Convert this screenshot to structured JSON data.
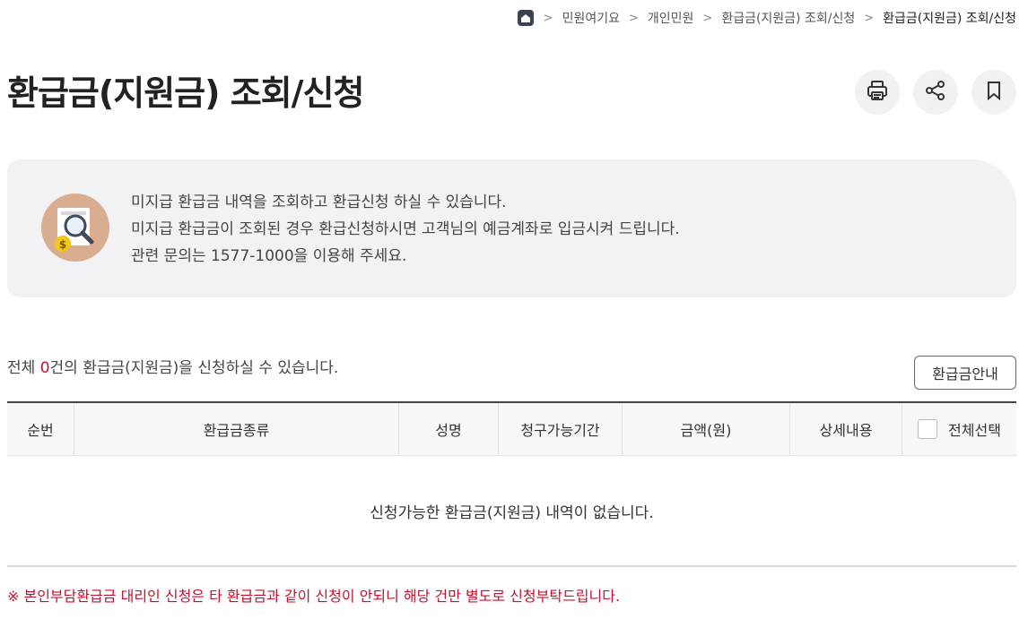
{
  "breadcrumb": {
    "home_icon": "home-icon",
    "items": [
      "민원여기요",
      "개인민원",
      "환급금(지원금) 조회/신청"
    ],
    "current": "환급금(지원금) 조회/신청"
  },
  "page": {
    "title": "환급금(지원금) 조회/신청",
    "tools": [
      "print-icon",
      "share-icon",
      "bookmark-icon"
    ]
  },
  "info": {
    "icon": "refund-search-icon",
    "lines": [
      "미지급 환급금 내역을 조회하고 환급신청 하실 수 있습니다.",
      "미지급 환급금이 조회된 경우 환급신청하시면 고객님의 예금계좌로 입금시켜 드립니다.",
      "관련 문의는 1577-1000을 이용해 주세요."
    ]
  },
  "summary": {
    "prefix": "전체 ",
    "count": "0",
    "suffix": "건의 환급금(지원금)을 신청하실 수 있습니다.",
    "guide_button": "환급금안내"
  },
  "table": {
    "headers": [
      "순번",
      "환급금종류",
      "성명",
      "청구가능기간",
      "금액(원)",
      "상세내용",
      "전체선택"
    ],
    "empty_message": "신청가능한 환급금(지원금) 내역이 없습니다."
  },
  "notice": "※ 본인부담환급금 대리인 신청은 타 환급금과 같이 신청이 안되니 해당 건만 별도로 신청부탁드립니다.",
  "colors": {
    "accent_red": "#c8102e",
    "info_bg": "#f2f2f4",
    "icon_circle": "#d9ae90",
    "coin": "#f5c518"
  }
}
